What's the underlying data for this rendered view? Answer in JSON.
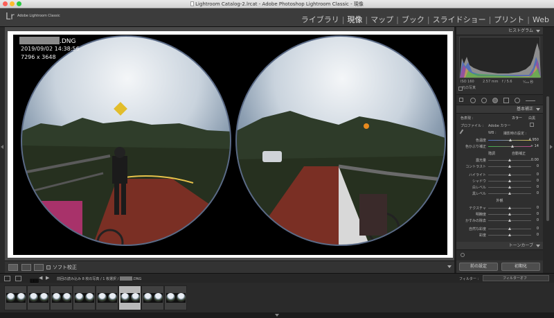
{
  "window": {
    "title": "Lightroom Catalog-2.lrcat - Adobe Photoshop Lightroom Classic - 現像"
  },
  "identity": {
    "logo": "Lr",
    "app_name": "Adobe Lightroom Classic"
  },
  "modules": [
    {
      "label": "ライブラリ",
      "active": false
    },
    {
      "label": "現像",
      "active": true
    },
    {
      "label": "マップ",
      "active": false
    },
    {
      "label": "ブック",
      "active": false
    },
    {
      "label": "スライドショー",
      "active": false
    },
    {
      "label": "プリント",
      "active": false
    },
    {
      "label": "Web",
      "active": false
    }
  ],
  "photo_info": {
    "filename": ".DNG",
    "datetime": "2019/09/02 14:38:56",
    "dimensions": "7296 x 3648"
  },
  "toolbar": {
    "soft_proof_label": "ソフト校正"
  },
  "histogram": {
    "title": "ヒストグラム",
    "iso": "ISO 160",
    "focal": "2.57 mm",
    "aperture": "f / 5.6",
    "shutter": "¹⁄₁₁₆ 秒",
    "original_photo": "元の写真"
  },
  "basic": {
    "title": "基本補正",
    "treatment_label": "色表現 :",
    "treatment_value": "カラー",
    "treatment_alt": "白黒",
    "profile_label": "プロファイル :",
    "profile_value": "Adobe カラー",
    "wb_label": "WB :",
    "wb_value": "撮影時の設定 :",
    "temp_label": "色温度",
    "temp_value": "4,950",
    "tint_label": "色かぶり補正",
    "tint_value": "+ 14",
    "tone_label": "階調",
    "tone_auto": "自動補正",
    "exposure_label": "露光量",
    "exposure_value": "0.00",
    "contrast_label": "コントラスト",
    "contrast_value": "0",
    "highlights_label": "ハイライト",
    "highlights_value": "0",
    "shadows_label": "シャドウ",
    "shadows_value": "0",
    "whites_label": "白レベル",
    "whites_value": "0",
    "blacks_label": "黒レベル",
    "blacks_value": "0",
    "presence_label": "外観",
    "texture_label": "テクスチャ",
    "texture_value": "0",
    "clarity_label": "明瞭度",
    "clarity_value": "0",
    "dehaze_label": "かすみの除去",
    "dehaze_value": "0",
    "vibrance_label": "自然な彩度",
    "vibrance_value": "0",
    "saturation_label": "彩度",
    "saturation_value": "0"
  },
  "tone_curve": {
    "title": "トーンカーブ"
  },
  "panel_buttons": {
    "previous": "前の設定",
    "reset": "初期化"
  },
  "filmstrip": {
    "info": "前回の読み込み  8 枚の写真 / 1 枚選択 /",
    "selected_suffix": ".DNG",
    "filter_label": "フィルター :",
    "filter_value": "フィルターオフ",
    "thumb_count": 8,
    "selected_index": 5
  }
}
